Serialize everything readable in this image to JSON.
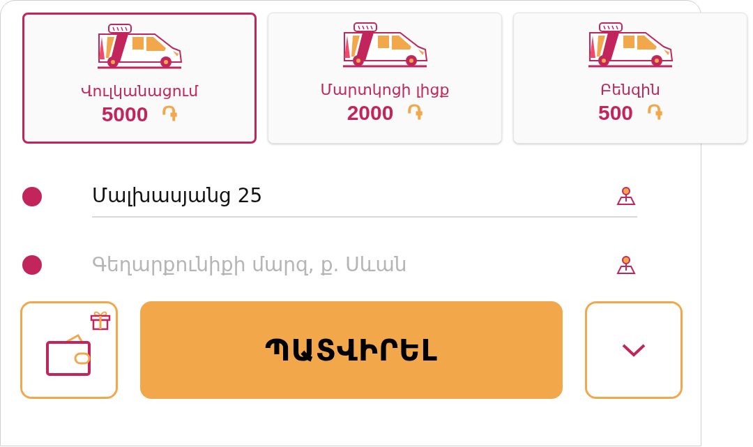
{
  "services": [
    {
      "name": "Վուլկանացում",
      "price": "5000",
      "currency": "֏",
      "selected": true
    },
    {
      "name": "Մարտկոցի լիցք",
      "price": "2000",
      "currency": "֏",
      "selected": false
    },
    {
      "name": "Բենզին",
      "price": "500",
      "currency": "֏",
      "selected": false
    }
  ],
  "route": [
    {
      "kind": "value",
      "text": "Մալխասյանց 25"
    },
    {
      "kind": "placeholder",
      "text": "Գեղարքունիքի մարզ, ք. Սևան"
    }
  ],
  "confirm_button": "ՊԱՏՎԻՐԵԼ"
}
